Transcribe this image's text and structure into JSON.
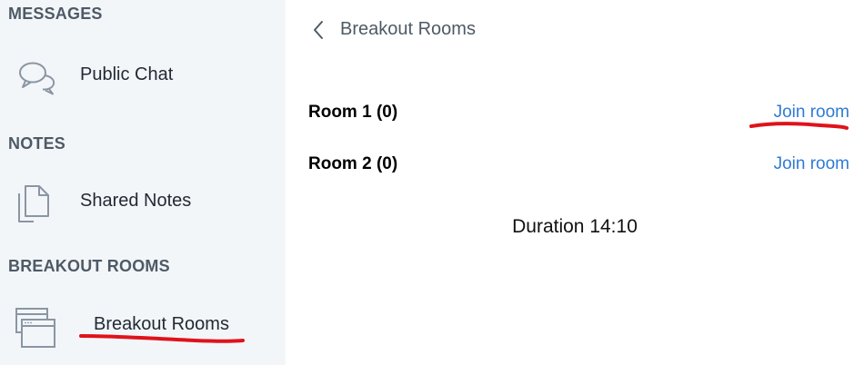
{
  "sidebar": {
    "sections": [
      {
        "title": "MESSAGES",
        "items": [
          {
            "label": "Public Chat",
            "icon": "chat-bubbles-icon"
          }
        ]
      },
      {
        "title": "NOTES",
        "items": [
          {
            "label": "Shared Notes",
            "icon": "documents-icon"
          }
        ]
      },
      {
        "title": "BREAKOUT ROOMS",
        "items": [
          {
            "label": "Breakout Rooms",
            "icon": "breakout-windows-icon"
          }
        ]
      }
    ]
  },
  "panel": {
    "title": "Breakout Rooms",
    "back_icon": "chevron-left-icon",
    "rooms": [
      {
        "name": "Room 1 (0)",
        "action": "Join room"
      },
      {
        "name": "Room 2 (0)",
        "action": "Join room"
      }
    ],
    "duration": "Duration 14:10"
  },
  "colors": {
    "sidebar_bg": "#f3f6f9",
    "link": "#2f7bd4",
    "section_title": "#4e5a66",
    "annotation": "#e0121b"
  }
}
